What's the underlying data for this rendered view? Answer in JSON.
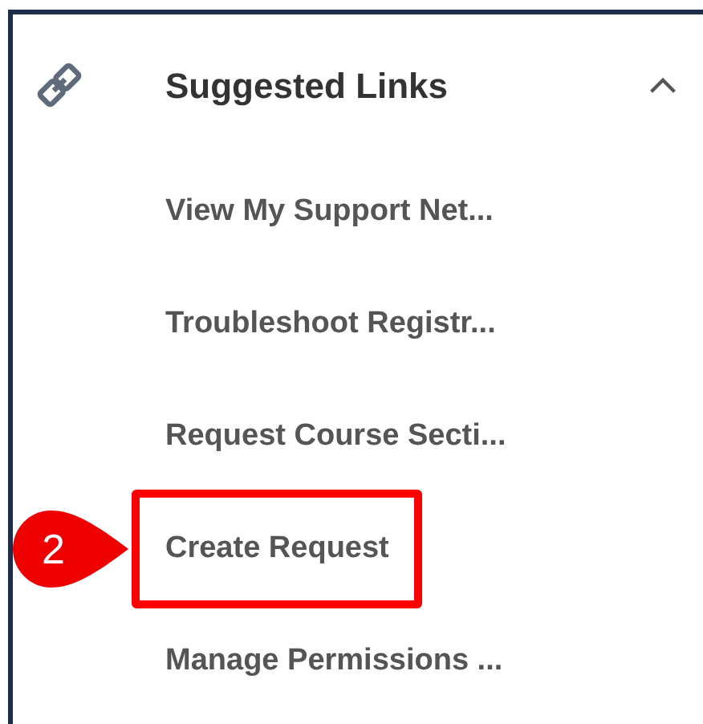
{
  "panel": {
    "title": "Suggested Links",
    "expanded": true,
    "links": [
      {
        "label": "View My Support Net...",
        "highlighted": false
      },
      {
        "label": "Troubleshoot Registr...",
        "highlighted": false
      },
      {
        "label": "Request Course Secti...",
        "highlighted": false
      },
      {
        "label": "Create Request",
        "highlighted": true,
        "callout": "2"
      },
      {
        "label": "Manage Permissions ...",
        "highlighted": false
      }
    ]
  }
}
